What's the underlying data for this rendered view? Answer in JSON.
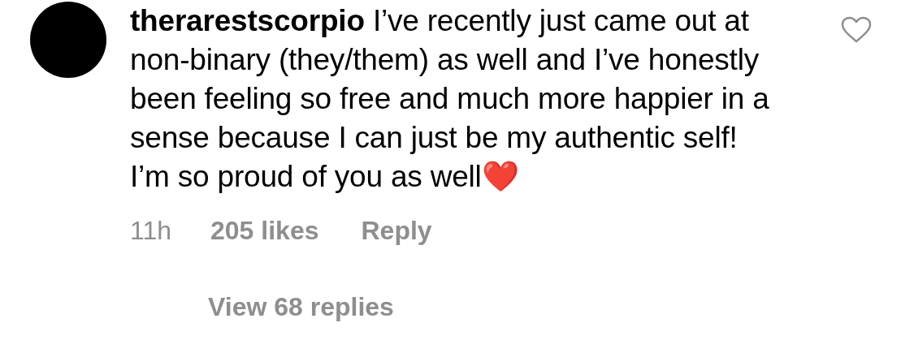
{
  "comment": {
    "username": "therarestscorpio",
    "text": "I’ve recently just came out at non-binary (they/them) as well and I’ve honestly been feeling so free and much more happier in a sense because I can just be my authentic self! I’m so proud of you as well❤️",
    "liked": false,
    "time": "11h",
    "likes": "205 likes",
    "reply": "Reply",
    "view_replies": "View 68 replies"
  }
}
